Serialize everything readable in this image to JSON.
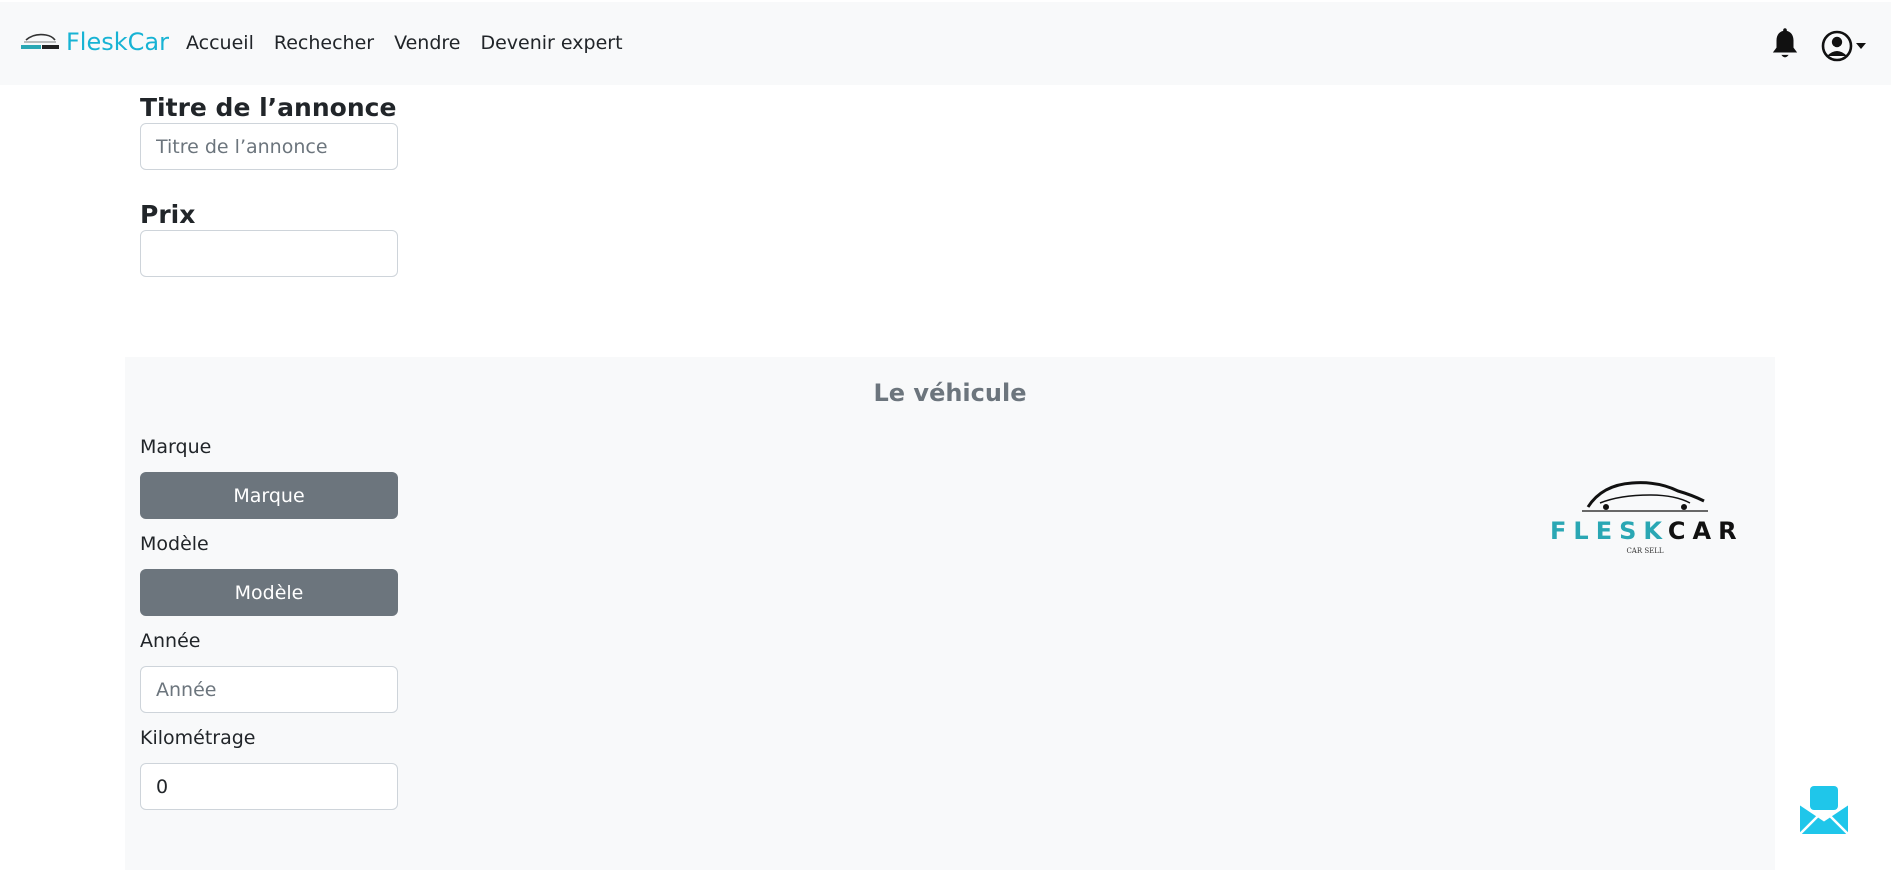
{
  "brand": {
    "name": "FleskCar"
  },
  "nav": {
    "items": [
      {
        "label": "Accueil"
      },
      {
        "label": "Rechecher"
      },
      {
        "label": "Vendre"
      },
      {
        "label": "Devenir expert"
      }
    ]
  },
  "form": {
    "title": {
      "label": "Titre de l’annonce",
      "placeholder": "Titre de l’annonce",
      "value": ""
    },
    "price": {
      "label": "Prix",
      "value": ""
    }
  },
  "vehicle": {
    "heading": "Le véhicule",
    "brand": {
      "label": "Marque",
      "button": "Marque"
    },
    "model": {
      "label": "Modèle",
      "button": "Modèle"
    },
    "year": {
      "label": "Année",
      "placeholder": "Année",
      "value": ""
    },
    "mileage": {
      "label": "Kilométrage",
      "value": "0"
    }
  },
  "logo": {
    "word_left": "FLESK",
    "word_right": "CAR",
    "tagline": "CAR SELL"
  },
  "colors": {
    "brand": "#17b3d4",
    "secondary_button": "#6c757d",
    "navbar_bg": "#f8f9fa",
    "chat": "#1fc6ea"
  },
  "icons": {
    "notifications": "bell-icon",
    "account": "user-circle-icon",
    "chat": "mail-chat-icon"
  }
}
